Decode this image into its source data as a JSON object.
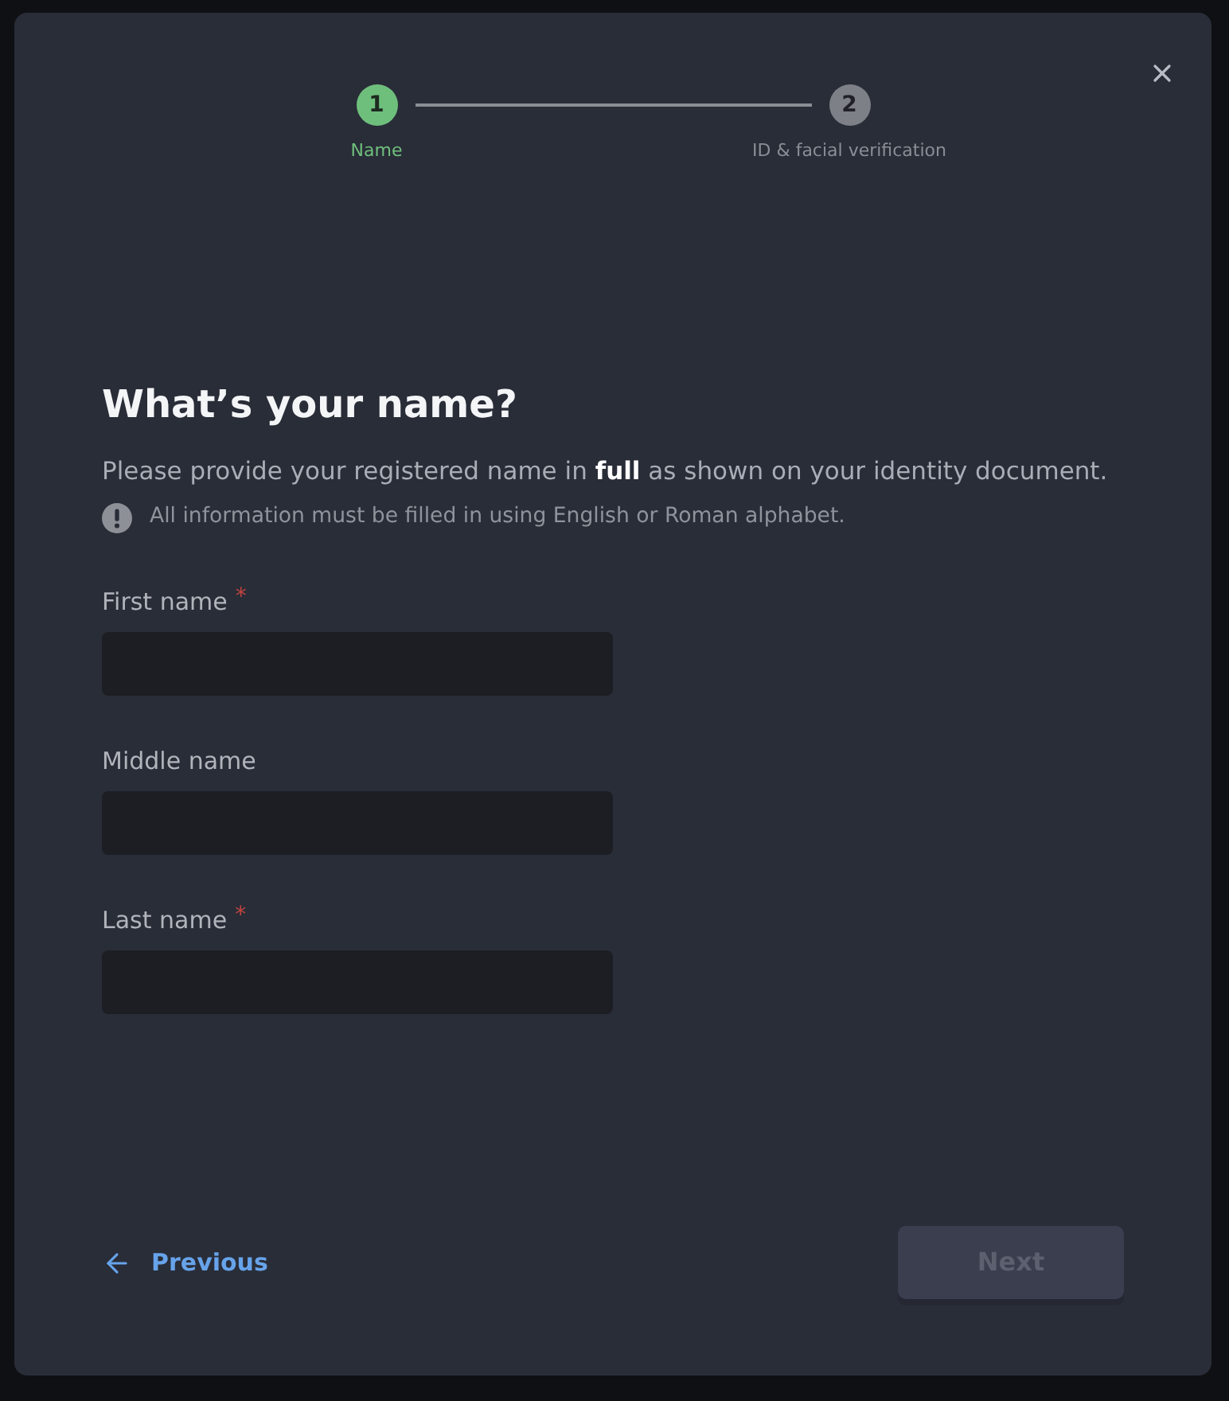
{
  "stepper": {
    "steps": [
      {
        "number": "1",
        "label": "Name",
        "selected": true
      },
      {
        "number": "2",
        "label": "ID & facial verification",
        "selected": false
      }
    ]
  },
  "heading": "What’s your name?",
  "description": "Please provide your registered name in **full** as shown on your identity document.",
  "notice": "All information must be filled in using English or Roman alphabet.",
  "fields": [
    {
      "label": "First name",
      "required_mark": "*"
    },
    {
      "label": "Middle name"
    },
    {
      "label": "Last name",
      "required_mark": "*"
    }
  ],
  "footer": {
    "previous": "Previous",
    "next": {
      "label": "Next",
      "disabled": true
    }
  }
}
